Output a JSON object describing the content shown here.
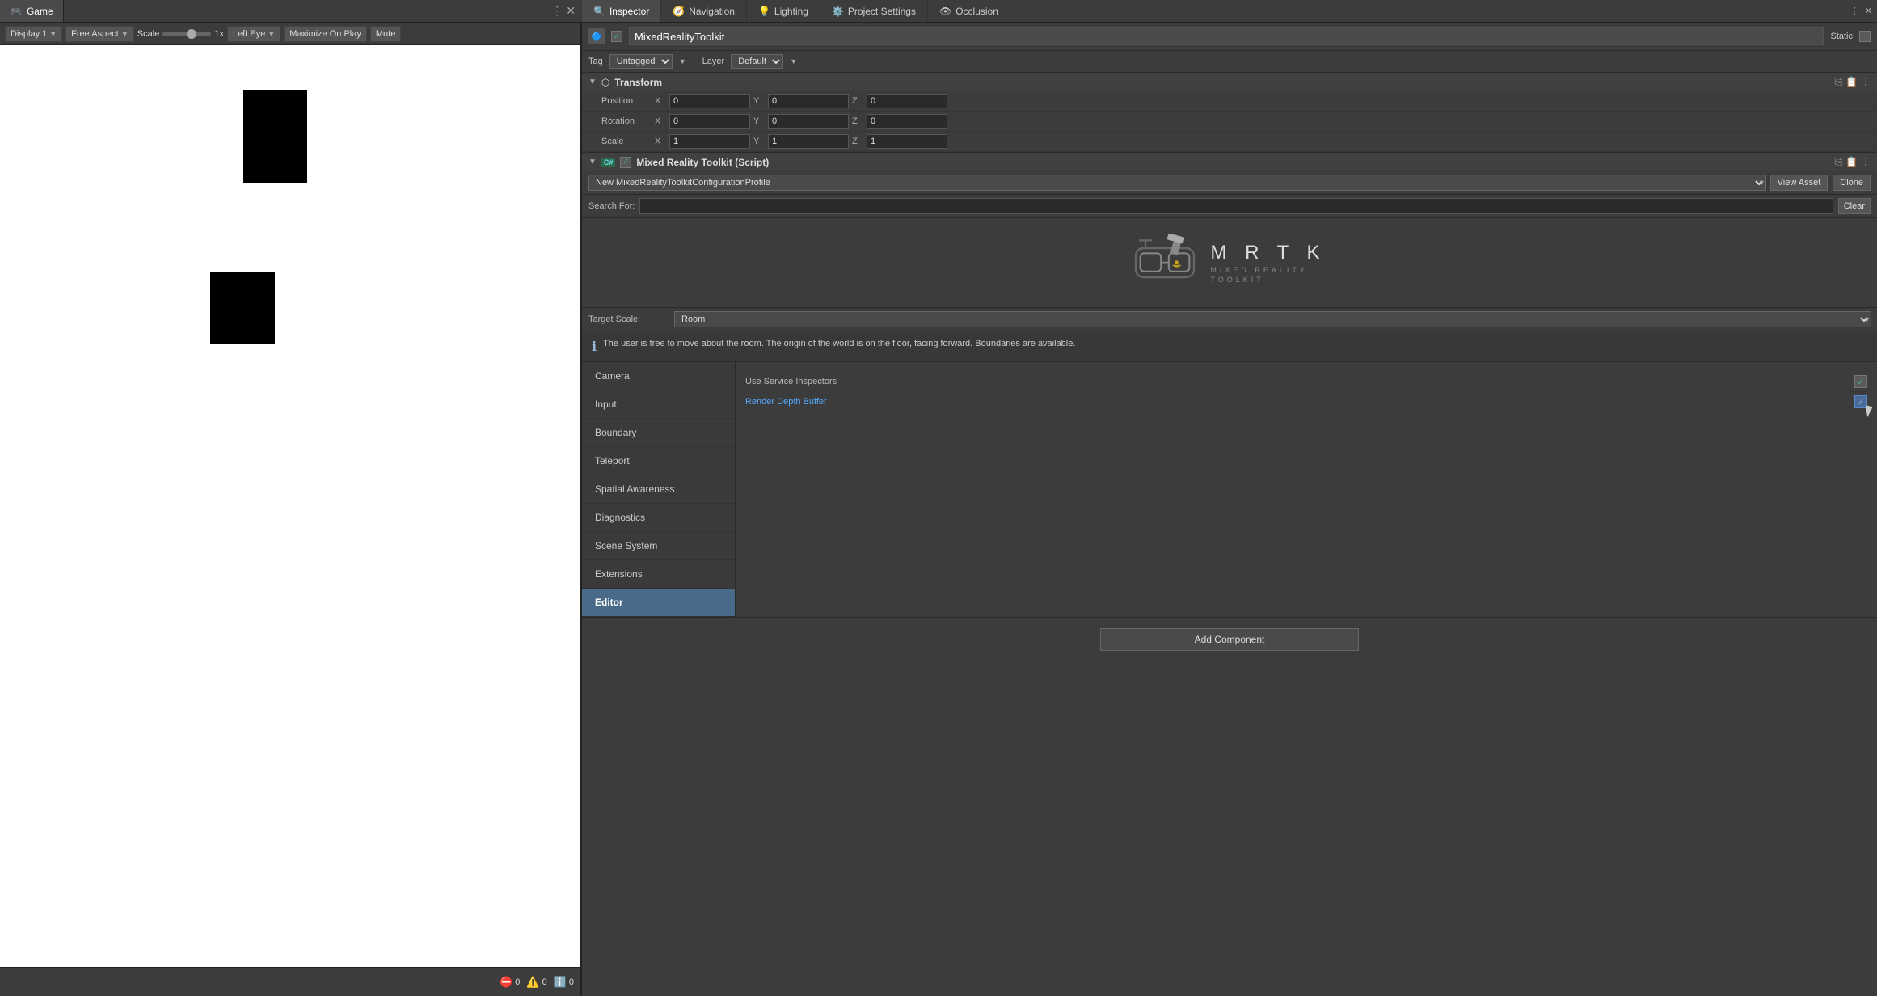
{
  "tabs": {
    "game": {
      "label": "Game",
      "icon": "🎮",
      "active": true
    },
    "inspector": {
      "label": "Inspector",
      "active": true
    },
    "navigation": {
      "label": "Navigation",
      "icon": "🧭"
    },
    "lighting": {
      "label": "Lighting",
      "icon": "💡"
    },
    "project_settings": {
      "label": "Project Settings",
      "icon": "⚙️"
    },
    "occlusion": {
      "label": "Occlusion",
      "icon": "👁"
    }
  },
  "game_toolbar": {
    "display_label": "Display 1",
    "aspect_label": "Free Aspect",
    "scale_label": "Scale",
    "scale_value": "1x",
    "eye_label": "Left Eye",
    "maximize_label": "Maximize On Play",
    "mute_label": "Mute"
  },
  "status_bar": {
    "error_count": "0",
    "warning_count": "0",
    "info_count": "0"
  },
  "inspector": {
    "object_name": "MixedRealityToolkit",
    "static_label": "Static",
    "tag_label": "Tag",
    "tag_value": "Untagged",
    "layer_label": "Layer",
    "layer_value": "Default",
    "transform": {
      "title": "Transform",
      "position_label": "Position",
      "rotation_label": "Rotation",
      "scale_label": "Scale",
      "pos_x": "0",
      "pos_y": "0",
      "pos_z": "0",
      "rot_x": "0",
      "rot_y": "0",
      "rot_z": "0",
      "scale_x": "1",
      "scale_y": "1",
      "scale_z": "1"
    },
    "script": {
      "title": "Mixed Reality Toolkit (Script)",
      "profile_value": "New MixedRealityToolkitConfigurationProfile",
      "view_asset_btn": "View Asset",
      "clone_btn": "Clone",
      "search_label": "Search For:",
      "search_placeholder": "",
      "clear_btn": "Clear"
    },
    "mrtk_logo": {
      "title": "M R T K",
      "subtitle_line1": "MIXED REALITY",
      "subtitle_line2": "TOOLKIT"
    },
    "target_scale": {
      "label": "Target Scale:",
      "value": "Room"
    },
    "info_text": "The user is free to move about the room. The origin of the world is on the floor, facing forward. Boundaries are available.",
    "services": [
      {
        "label": "Camera",
        "active": false
      },
      {
        "label": "Input",
        "active": false
      },
      {
        "label": "Boundary",
        "active": false
      },
      {
        "label": "Teleport",
        "active": false
      },
      {
        "label": "Spatial Awareness",
        "active": false
      },
      {
        "label": "Diagnostics",
        "active": false
      },
      {
        "label": "Scene System",
        "active": false
      },
      {
        "label": "Extensions",
        "active": false
      },
      {
        "label": "Editor",
        "active": true
      }
    ],
    "service_details": {
      "use_service_label": "Use Service Inspectors",
      "render_depth_label": "Render Depth Buffer"
    },
    "add_component_btn": "Add Component"
  }
}
